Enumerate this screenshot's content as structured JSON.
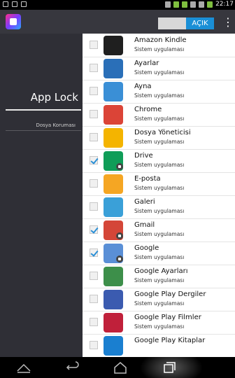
{
  "status_bar": {
    "time": "22:17"
  },
  "action_bar": {
    "toggle_on_label": "AÇIK",
    "overflow_icon": "overflow-menu-icon"
  },
  "nav": {
    "title": "App Lock",
    "items": [
      {
        "label": "Dosya Koruması"
      }
    ]
  },
  "apps": [
    {
      "name": "Amazon Kindle",
      "subtitle": "Sistem uygulaması",
      "checked": false,
      "locked": false,
      "icon": "kindle-icon",
      "color": "#1f1f1f"
    },
    {
      "name": "Ayarlar",
      "subtitle": "Sistem uygulaması",
      "checked": false,
      "locked": false,
      "icon": "settings-gear-icon",
      "color": "#2a6fb8"
    },
    {
      "name": "Ayna",
      "subtitle": "Sistem uygulaması",
      "checked": false,
      "locked": false,
      "icon": "mirror-icon",
      "color": "#3a8fd6"
    },
    {
      "name": "Chrome",
      "subtitle": "Sistem uygulaması",
      "checked": false,
      "locked": false,
      "icon": "chrome-icon",
      "color": "#db4437"
    },
    {
      "name": "Dosya Yöneticisi",
      "subtitle": "Sistem uygulaması",
      "checked": false,
      "locked": false,
      "icon": "folder-icon",
      "color": "#f4b400"
    },
    {
      "name": "Drive",
      "subtitle": "Sistem uygulaması",
      "checked": true,
      "locked": true,
      "icon": "drive-icon",
      "color": "#0f9d58"
    },
    {
      "name": "E-posta",
      "subtitle": "Sistem uygulaması",
      "checked": false,
      "locked": false,
      "icon": "email-envelope-icon",
      "color": "#f5a623"
    },
    {
      "name": "Galeri",
      "subtitle": "Sistem uygulaması",
      "checked": false,
      "locked": false,
      "icon": "gallery-icon",
      "color": "#3aa0d8"
    },
    {
      "name": "Gmail",
      "subtitle": "Sistem uygulaması",
      "checked": true,
      "locked": true,
      "icon": "gmail-icon",
      "color": "#d44638"
    },
    {
      "name": "Google",
      "subtitle": "Sistem uygulaması",
      "checked": true,
      "locked": true,
      "icon": "google-search-icon",
      "color": "#5a8fd6"
    },
    {
      "name": "Google Ayarları",
      "subtitle": "Sistem uygulaması",
      "checked": false,
      "locked": false,
      "icon": "google-settings-icon",
      "color": "#3d8f4a"
    },
    {
      "name": "Google Play Dergiler",
      "subtitle": "Sistem uygulaması",
      "checked": false,
      "locked": false,
      "icon": "play-magazines-icon",
      "color": "#3b5bb0"
    },
    {
      "name": "Google Play Filmler",
      "subtitle": "Sistem uygulaması",
      "checked": false,
      "locked": false,
      "icon": "play-movies-icon",
      "color": "#c0203a"
    },
    {
      "name": "Google Play Kitaplar",
      "subtitle": "",
      "checked": false,
      "locked": false,
      "icon": "play-books-icon",
      "color": "#1a7fd0"
    }
  ],
  "colors": {
    "accent": "#1a8fd6",
    "background": "#2f2f36",
    "panel": "#ffffff"
  }
}
